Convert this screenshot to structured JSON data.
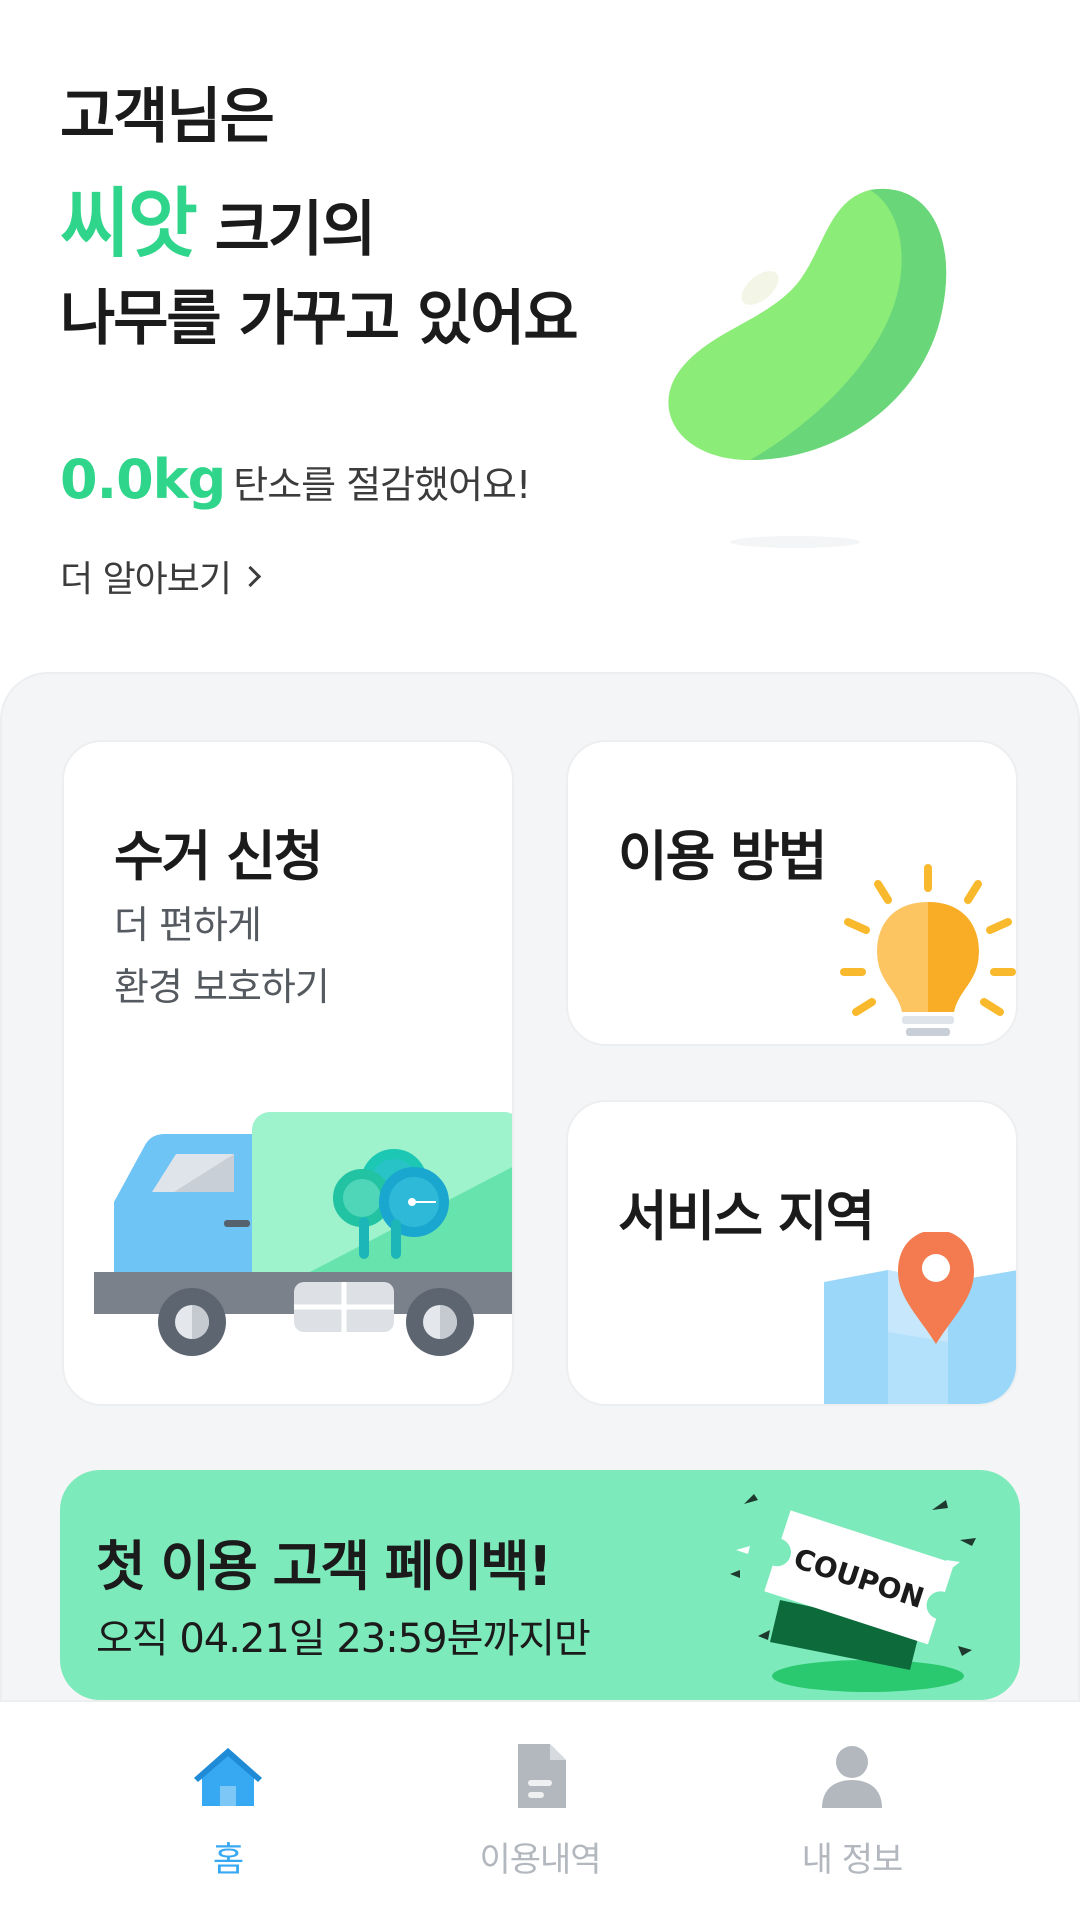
{
  "hero": {
    "line1": "고객님은",
    "line2_accent": "씨앗",
    "line2_rest": " 크기의",
    "line3": "나무를 가꾸고 있어요",
    "carbon_value": "0.0kg",
    "carbon_suffix": "탄소를 절감했어요!",
    "learn_more": "더 알아보기"
  },
  "cards": {
    "pickup": {
      "title": "수거 신청",
      "sub1": "더 편하게",
      "sub2": "환경 보호하기"
    },
    "howto": {
      "title": "이용 방법"
    },
    "region": {
      "title": "서비스 지역"
    }
  },
  "promo": {
    "title": "첫 이용 고객 페이백!",
    "subtitle": "오직 04.21일 23:59분까지만",
    "coupon_text": "COUPON"
  },
  "nav": {
    "items": [
      {
        "label": "홈",
        "icon": "home-icon",
        "active": true
      },
      {
        "label": "이용내역",
        "icon": "document-icon",
        "active": false
      },
      {
        "label": "내 정보",
        "icon": "person-icon",
        "active": false
      }
    ]
  },
  "colors": {
    "accent_green": "#2fd58a",
    "promo_bg": "#7deabb",
    "nav_active": "#37a9f2",
    "nav_inactive": "#b3b8bf",
    "panel_bg": "#f4f5f6"
  }
}
